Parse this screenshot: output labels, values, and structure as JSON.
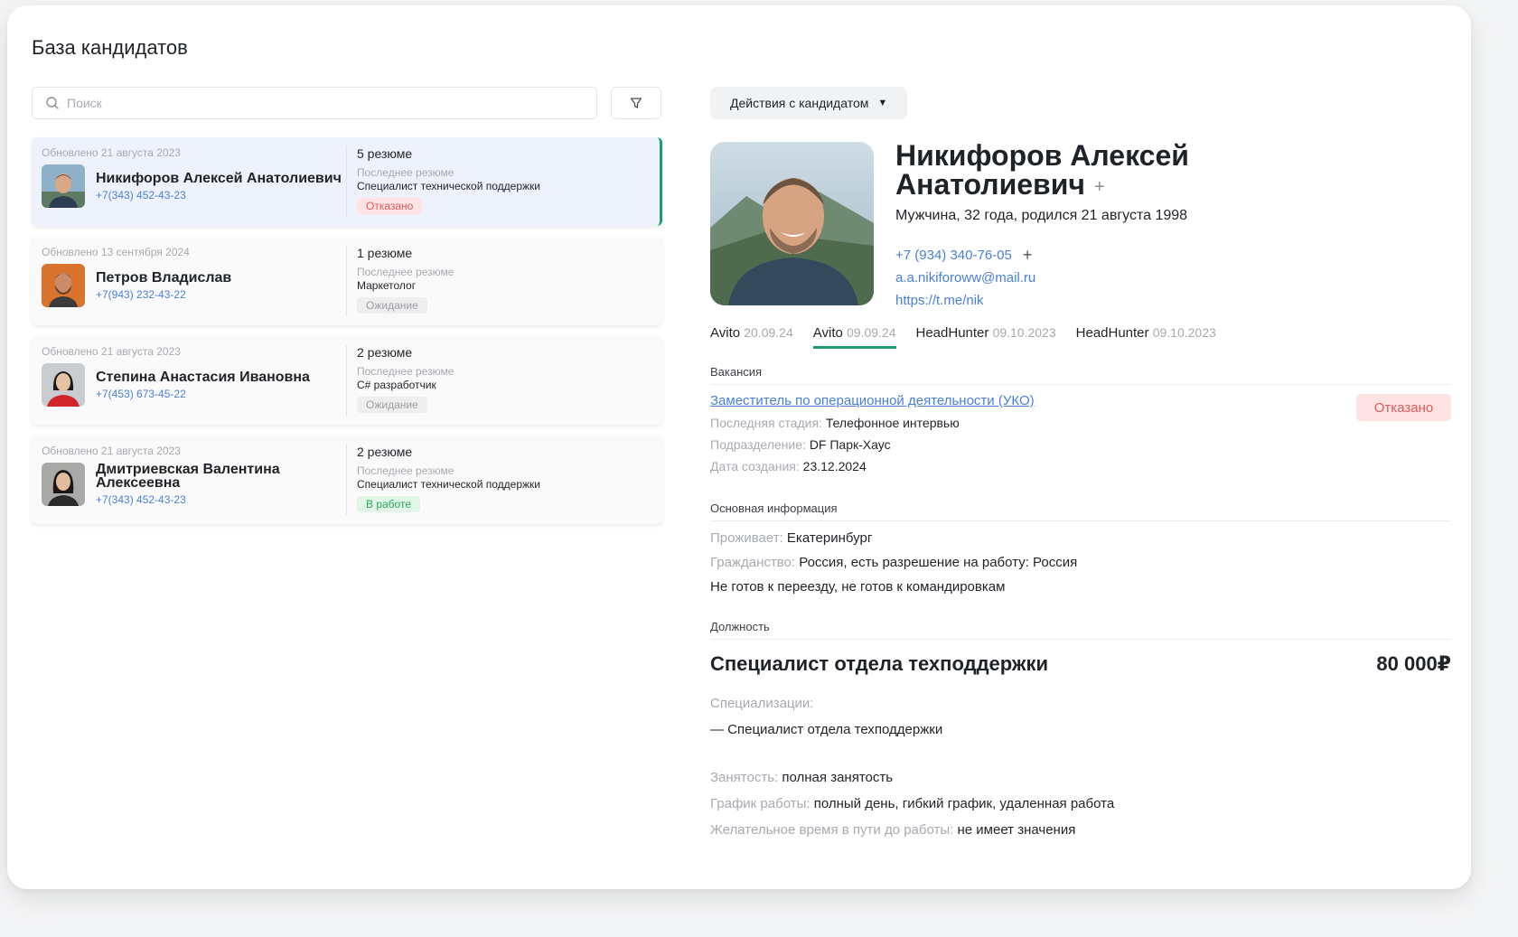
{
  "page": {
    "title": "База кандидатов"
  },
  "search": {
    "placeholder": "Поиск"
  },
  "candidates": [
    {
      "updated": "Обновлено 21 августа 2023",
      "name": "Никифоров Алексей Анатолиевич",
      "phone": "+7(343) 452-43-23",
      "resume_count": "5 резюме",
      "last_resume_label": "Последнее резюме",
      "last_resume": "Специалист технической поддержки",
      "status": "Отказано"
    },
    {
      "updated": "Обновлено 13 сентября 2024",
      "name": "Петров Владислав",
      "phone": "+7(943) 232-43-22",
      "resume_count": "1 резюме",
      "last_resume_label": "Последнее резюме",
      "last_resume": "Маркетолог",
      "status": "Ожидание"
    },
    {
      "updated": "Обновлено 21 августа 2023",
      "name": "Степина Анастасия Ивановна",
      "phone": "+7(453) 673-45-22",
      "resume_count": "2 резюме",
      "last_resume_label": "Последнее резюме",
      "last_resume": "C# разработчик",
      "status": "Ожидание"
    },
    {
      "updated": "Обновлено 21 августа 2023",
      "name": "Дмитриевская Валентина Алексеевна",
      "phone": "+7(343) 452-43-23",
      "resume_count": "2 резюме",
      "last_resume_label": "Последнее резюме",
      "last_resume": "Специалист технической поддержки",
      "status": "В работе"
    }
  ],
  "profile": {
    "actions_label": "Действия с кандидатом",
    "name_line1": "Никифоров Алексей",
    "name_line2": "Анатолиевич",
    "subtitle": "Мужчина, 32 года, родился 21 августа 1998",
    "phone": "+7 (934) 340-76-05",
    "email": "a.a.nikiforoww@mail.ru",
    "telegram": "https://t.me/nik"
  },
  "sources": [
    {
      "name": "Avito",
      "date": "20.09.24"
    },
    {
      "name": "Avito",
      "date": "09.09.24"
    },
    {
      "name": "HeadHunter",
      "date": "09.10.2023"
    },
    {
      "name": "HeadHunter",
      "date": "09.10.2023"
    }
  ],
  "vacancy": {
    "section_title": "Вакансия",
    "title": "Заместитель по операционной деятельности (УКО)",
    "status": "Отказано",
    "stage_label": "Последняя стадия:",
    "stage": "Телефонное интервью",
    "division_label": "Подразделение:",
    "division": "DF Парк-Хаус",
    "created_label": "Дата создания:",
    "created": "23.12.2024"
  },
  "basic_info": {
    "section_title": "Основная информация",
    "lives_label": "Проживает:",
    "lives": "Екатеринбург",
    "citizenship_label": "Гражданство:",
    "citizenship": "Россия, есть разрешение на работу: Россия",
    "relocation": "Не готов к переезду, не готов к командировкам"
  },
  "position": {
    "section_title": "Должность",
    "title": "Специалист отдела техподдержки",
    "salary": "80 000₽",
    "spec_label": "Специализации:",
    "spec": "— Специалист отдела техподдержки",
    "employment_label": "Занятость:",
    "employment": "полная занятость",
    "schedule_label": "График работы:",
    "schedule": "полный день, гибкий график, удаленная работа",
    "commute_label": "Желательное время в пути до работы:",
    "commute": "не имеет значения"
  },
  "colors": {
    "accent_green": "#1f9c6e",
    "link_blue": "#4a7fd9",
    "rejected_red": "#e05a5a",
    "working_green": "#2aa65c"
  }
}
